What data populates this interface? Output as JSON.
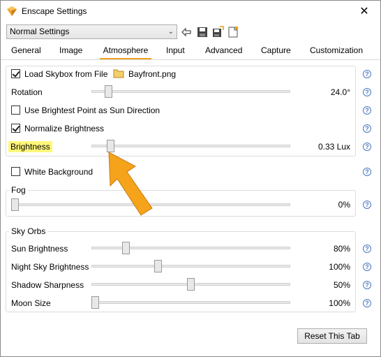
{
  "window": {
    "title": "Enscape Settings"
  },
  "toolbar": {
    "preset": "Normal Settings",
    "icons": [
      "undo-icon",
      "save-icon",
      "save-as-icon",
      "new-preset-icon"
    ]
  },
  "tabs": [
    {
      "label": "General",
      "active": false
    },
    {
      "label": "Image",
      "active": false
    },
    {
      "label": "Atmosphere",
      "active": true
    },
    {
      "label": "Input",
      "active": false
    },
    {
      "label": "Advanced",
      "active": false
    },
    {
      "label": "Capture",
      "active": false
    },
    {
      "label": "Customization",
      "active": false
    }
  ],
  "skybox": {
    "load_label": "Load Skybox from File",
    "load_checked": true,
    "file": "Bayfront.png",
    "rotation_label": "Rotation",
    "rotation_value": "24.0°",
    "rotation_fraction": 0.07,
    "brightest_label": "Use Brightest Point as Sun Direction",
    "brightest_checked": false,
    "normalize_label": "Normalize Brightness",
    "normalize_checked": true,
    "brightness_label": "Brightness",
    "brightness_value": "0.33 Lux",
    "brightness_fraction": 0.08
  },
  "white_background": {
    "label": "White Background",
    "checked": false
  },
  "fog": {
    "title": "Fog",
    "value": "0%",
    "fraction": 0.0
  },
  "sky_orbs": {
    "title": "Sky Orbs",
    "rows": [
      {
        "label": "Sun Brightness",
        "value": "80%",
        "fraction": 0.16
      },
      {
        "label": "Night Sky Brightness",
        "value": "100%",
        "fraction": 0.33
      },
      {
        "label": "Shadow Sharpness",
        "value": "50%",
        "fraction": 0.5
      },
      {
        "label": "Moon Size",
        "value": "100%",
        "fraction": 0.0
      }
    ]
  },
  "help_symbol": "?",
  "reset_label": "Reset This Tab",
  "colors": {
    "accent_tab": "#f0a020",
    "highlight": "#fff77a",
    "annotation_arrow": "#f5a31a",
    "help": "#4a78c2"
  }
}
